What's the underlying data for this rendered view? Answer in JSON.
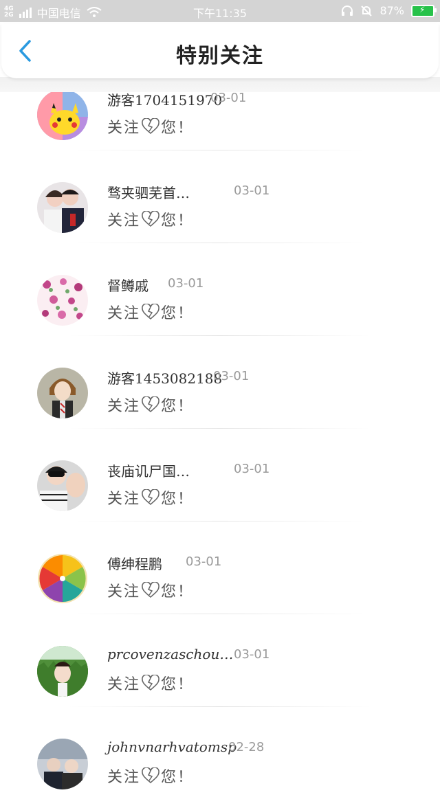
{
  "status_bar": {
    "network_top": "4G",
    "network_bottom": "2G",
    "carrier": "中国电信",
    "time": "下午11:35",
    "battery": "87%"
  },
  "header": {
    "title": "特别关注",
    "back_icon": "chevron-left-icon"
  },
  "colors": {
    "accent": "#2a9ae0",
    "status_bar_bg": "#d4d4d4",
    "battery_green": "#27c24a"
  },
  "items": [
    {
      "name": "游客1704151970",
      "date": "03-01",
      "msg_a": "关注",
      "msg_b": "您！",
      "avatar": "pikachu"
    },
    {
      "name": "骛夹驷芜首…",
      "date": "03-01",
      "msg_a": "关注",
      "msg_b": "您！",
      "avatar": "couple"
    },
    {
      "name": "督鳟戚",
      "date": "03-01",
      "msg_a": "关注",
      "msg_b": "您！",
      "avatar": "flowers"
    },
    {
      "name": "游客1453082188",
      "date": "03-01",
      "msg_a": "关注",
      "msg_b": "您！",
      "avatar": "anime-boy"
    },
    {
      "name": "丧庙讥尸国…",
      "date": "03-01",
      "msg_a": "关注",
      "msg_b": "您！",
      "avatar": "boy-hand"
    },
    {
      "name": "傅绅程鹏",
      "date": "03-01",
      "msg_a": "关注",
      "msg_b": "您！",
      "avatar": "citrus"
    },
    {
      "name": "prcovenzaschou…",
      "date": "03-01",
      "msg_a": "关注",
      "msg_b": "您！",
      "avatar": "girl-grass"
    },
    {
      "name": "johnvnarhvatomsp",
      "date": "02-28",
      "msg_a": "关注",
      "msg_b": "您！",
      "avatar": "people"
    }
  ]
}
